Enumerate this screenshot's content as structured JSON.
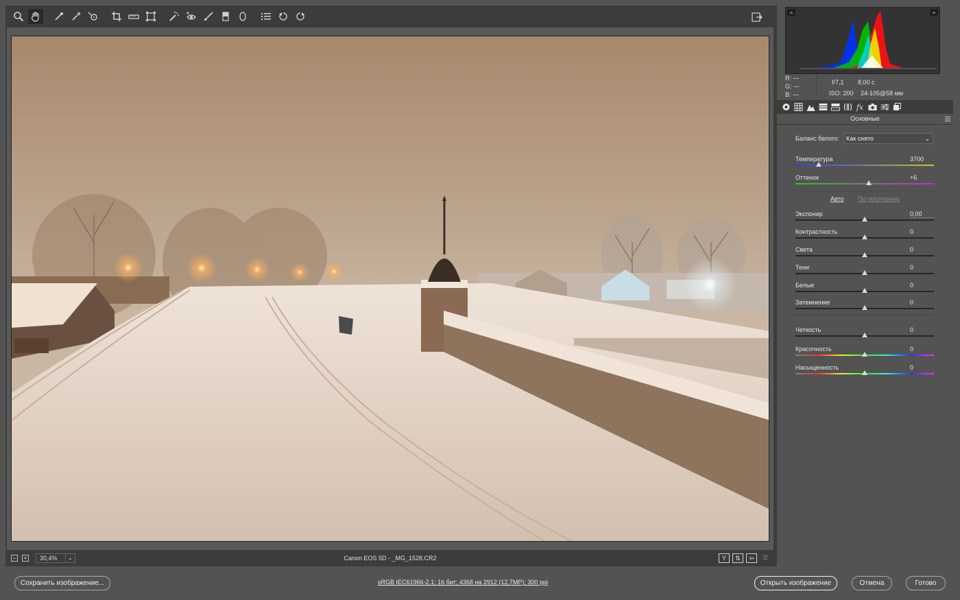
{
  "toolbar": {
    "tools": [
      "zoom-tool",
      "hand-tool",
      "white-balance-tool",
      "color-sampler-tool",
      "targeted-adjustment-tool",
      "crop-tool",
      "straighten-tool",
      "transform-tool",
      "spot-removal-tool",
      "red-eye-tool",
      "adjustment-brush",
      "graduated-filter",
      "radial-filter",
      "preferences",
      "rotate-left",
      "rotate-right"
    ],
    "active_tool": "hand-tool"
  },
  "status": {
    "zoom_minus": "−",
    "zoom_plus": "+",
    "zoom": "30,4%",
    "filename": "Canon EOS 5D  -  _MG_1528.CR2",
    "view_btn": "Y"
  },
  "histogram": {
    "readout_r_label": "R:",
    "readout_g_label": "G:",
    "readout_b_label": "B:",
    "readout_r": "---",
    "readout_g": "---",
    "readout_b": "---",
    "aperture": "f/7,1",
    "shutter": "8,00 с",
    "iso": "ISO: 200",
    "lens": "24-105@58 мм"
  },
  "panel": {
    "section_title": "Основные",
    "wb_label": "Баланс белого:",
    "wb_value": "Как снято",
    "auto": "Авто",
    "default": "По умолчанию",
    "sliders": [
      {
        "label": "Температура",
        "value": "3700",
        "pos": 0.17
      },
      {
        "label": "Оттенок",
        "value": "+6",
        "pos": 0.53
      },
      {
        "label": "Экспонир",
        "value": "0,00",
        "pos": 0.5
      },
      {
        "label": "Контрастность",
        "value": "0",
        "pos": 0.5
      },
      {
        "label": "Света",
        "value": "0",
        "pos": 0.5
      },
      {
        "label": "Тени",
        "value": "0",
        "pos": 0.5
      },
      {
        "label": "Белые",
        "value": "0",
        "pos": 0.5
      },
      {
        "label": "Затемнение",
        "value": "0",
        "pos": 0.5
      },
      {
        "label": "Четкость",
        "value": "0",
        "pos": 0.5
      },
      {
        "label": "Красочность",
        "value": "0",
        "pos": 0.5
      },
      {
        "label": "Насыщенность",
        "value": "0",
        "pos": 0.5
      }
    ]
  },
  "bottom": {
    "save": "Сохранить изображение...",
    "workflow": "sRGB IEC61966-2.1; 16 бит; 4368 на 2912 (12,7MP); 300 ppi",
    "open": "Открыть изображение",
    "cancel": "Отмена",
    "done": "Готово"
  },
  "colors": {
    "bg": "#535353",
    "dark": "#3c3c3c",
    "photo_sky": "#b59c84"
  }
}
